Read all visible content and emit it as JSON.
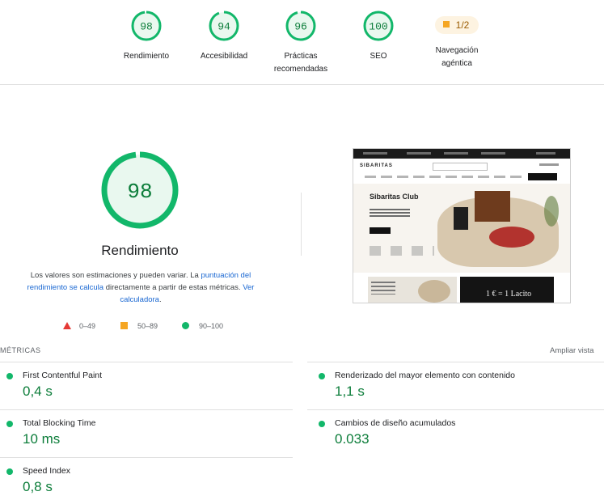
{
  "categories": [
    {
      "score": "98",
      "label": "Rendimiento",
      "value": 98
    },
    {
      "score": "94",
      "label": "Accesibilidad",
      "value": 94
    },
    {
      "score": "96",
      "label": "Prácticas recomendadas",
      "value": 96
    },
    {
      "score": "100",
      "label": "SEO",
      "value": 100
    }
  ],
  "agentic": {
    "fraction": "1/2",
    "label": "Navegación agéntica"
  },
  "performance": {
    "score": "98",
    "value": 98,
    "title": "Rendimiento",
    "desc_before": "Los valores son estimaciones y pueden variar. La ",
    "desc_link1": "puntuación del rendimiento se calcula",
    "desc_middle": " directamente a partir de estas métricas. ",
    "desc_link2": "Ver calculadora",
    "desc_after": "."
  },
  "legend": {
    "poor": "0–49",
    "average": "50–89",
    "good": "90–100"
  },
  "thumbnail": {
    "brand": "SIBARITAS",
    "hero_title": "Sibaritas Club",
    "card_text": "1 € = 1 Lacito"
  },
  "metrics_section": {
    "title": "MÉTRICAS",
    "expand": "Ampliar vista"
  },
  "metrics": [
    {
      "name": "First Contentful Paint",
      "value": "0,4 s"
    },
    {
      "name": "Renderizado del mayor elemento con contenido",
      "value": "1,1 s"
    },
    {
      "name": "Total Blocking Time",
      "value": "10 ms"
    },
    {
      "name": "Cambios de diseño acumulados",
      "value": "0.033"
    },
    {
      "name": "Speed Index",
      "value": "0,8 s"
    }
  ],
  "colors": {
    "pass": "#0c7d3a",
    "pass_ring": "#12b76a",
    "average": "#f5a623",
    "fail": "#e53935",
    "link": "#1967d2"
  }
}
